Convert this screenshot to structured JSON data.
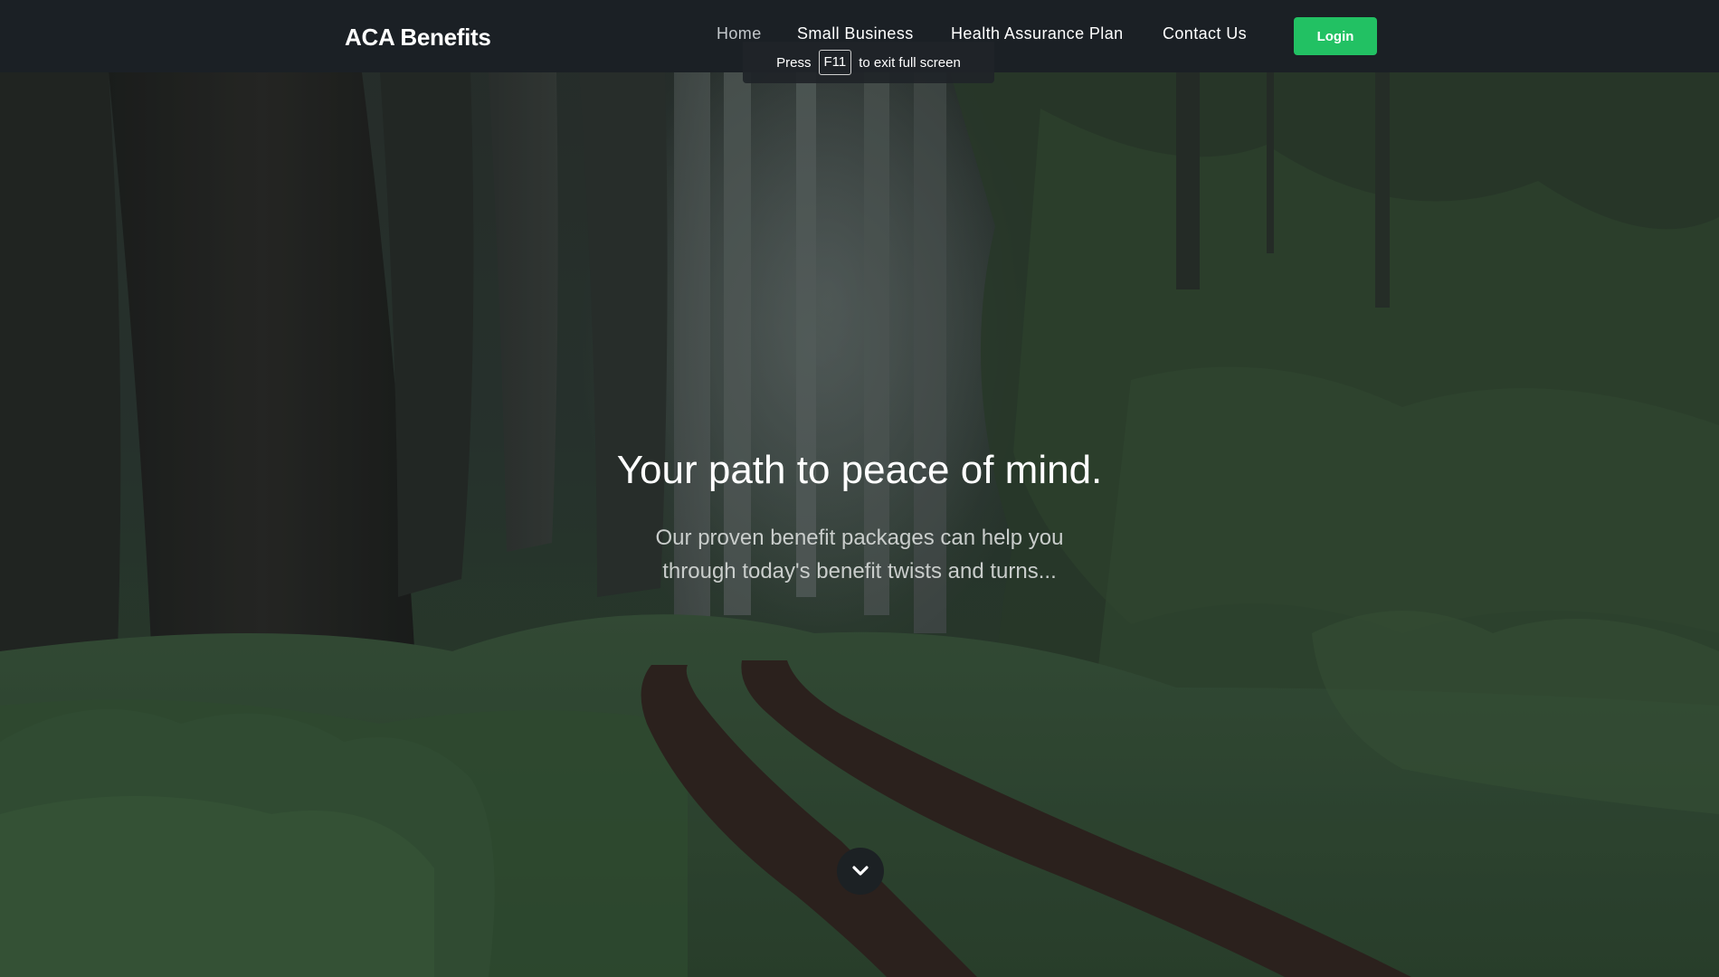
{
  "brand": {
    "name": "ACA Benefits"
  },
  "nav": {
    "items": [
      {
        "label": "Home",
        "active": true
      },
      {
        "label": "Small Business",
        "active": false
      },
      {
        "label": "Health Assurance Plan",
        "active": false
      },
      {
        "label": "Contact Us",
        "active": false
      }
    ],
    "login_label": "Login"
  },
  "fullscreen_notice": {
    "prefix": "Press",
    "key": "F11",
    "suffix": "to exit full screen"
  },
  "hero": {
    "title": "Your path to peace of mind.",
    "subtitle": "Our proven benefit packages can help you through today's benefit twists and turns...",
    "scroll_icon": "chevron-down-icon"
  },
  "colors": {
    "navbar_bg": "#1b2025",
    "login_button": "#22c163",
    "text": "#ffffff",
    "subtitle_text": "#c9cdcb"
  }
}
